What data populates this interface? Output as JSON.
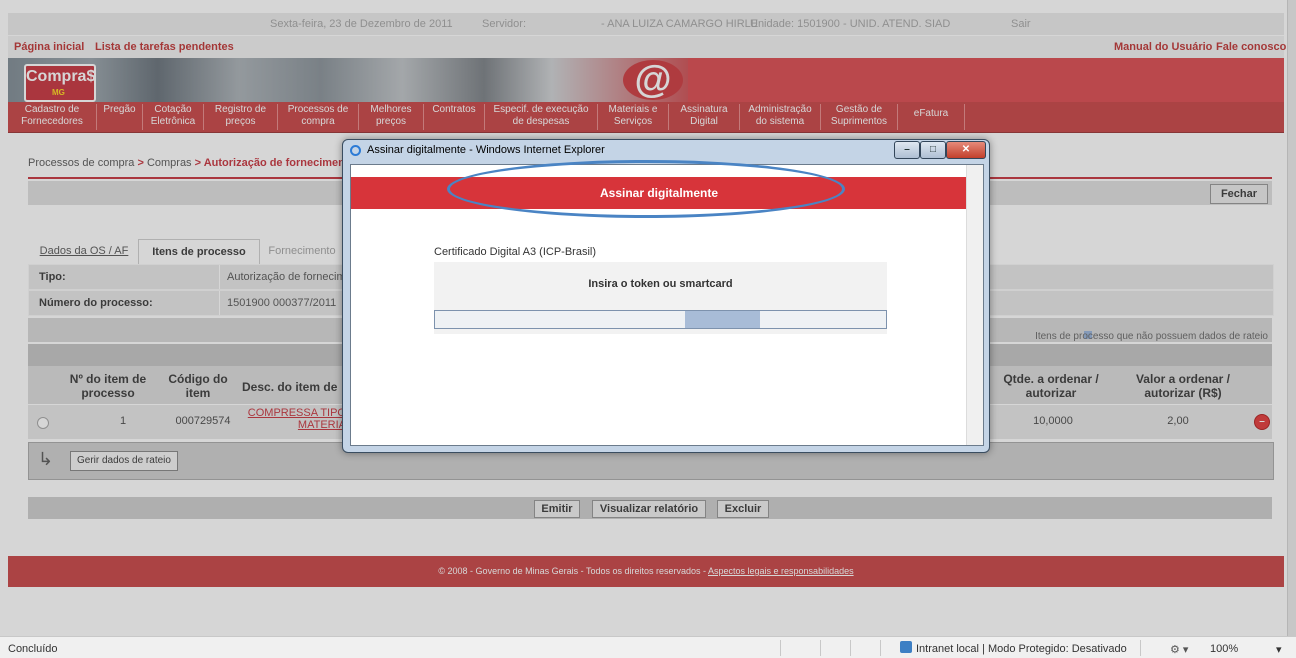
{
  "topbar": {
    "date": "Sexta-feira, 23 de Dezembro de 2011",
    "servidor_label": "Servidor:",
    "servidor_name": "- ANA LUIZA CAMARGO HIRLE",
    "unidade": "Unidade: 1501900 - UNID. ATEND. SIAD",
    "sair": "Sair"
  },
  "links": {
    "home": "Página inicial",
    "tasks": "Lista de tarefas pendentes",
    "manual": "Manual do Usuário",
    "contact": "Fale conosco"
  },
  "banner": {
    "logo": "Compra$",
    "logo_sub": "MG",
    "at": "@"
  },
  "nav": [
    {
      "line1": "Cadastro de",
      "line2": "Fornecedores"
    },
    {
      "line1": "Pregão",
      "line2": ""
    },
    {
      "line1": "Cotação",
      "line2": "Eletrônica"
    },
    {
      "line1": "Registro de",
      "line2": "preços"
    },
    {
      "line1": "Processos de",
      "line2": "compra"
    },
    {
      "line1": "Melhores",
      "line2": "preços"
    },
    {
      "line1": "Contratos",
      "line2": ""
    },
    {
      "line1": "Especif. de execução",
      "line2": "de despesas"
    },
    {
      "line1": "Materiais e",
      "line2": "Serviços"
    },
    {
      "line1": "Assinatura",
      "line2": "Digital"
    },
    {
      "line1": "Administração",
      "line2": "do sistema"
    },
    {
      "line1": "Gestão de",
      "line2": "Suprimentos"
    },
    {
      "line1": "eFatura",
      "line2": ""
    }
  ],
  "breadcrumb": {
    "part1": "Processos de compra",
    "sep": " > ",
    "part2": "Compras",
    "part3": "Autorização de fornecimen"
  },
  "buttons": {
    "fechar": "Fechar",
    "gerir_rateio": "Gerir dados de rateio",
    "emitir": "Emitir",
    "visualizar": "Visualizar relatório",
    "excluir": "Excluir"
  },
  "tabs": [
    "Dados da OS / AF",
    "Itens de processo",
    "Fornecimento"
  ],
  "info": {
    "tipo_label": "Tipo:",
    "tipo_value": "Autorização de fornecim",
    "numero_label": "Número do processo:",
    "numero_value": "1501900 000377/2011"
  },
  "legend": "Itens de processo que não possuem dados de rateio",
  "table": {
    "headers": {
      "item": "Nº do item de processo",
      "codigo": "Código do item",
      "desc": "Desc. do item de",
      "qtde": "Qtde. a ordenar / autorizar",
      "valor": "Valor a ordenar / autorizar (R$)"
    },
    "row": {
      "item": "1",
      "codigo": "000729574",
      "desc_line1": "COMPRESSA TIPO",
      "desc_line2": "MATERIA",
      "qtde": "10,0000",
      "valor": "2,00"
    }
  },
  "footer": {
    "text": "© 2008 - Governo de Minas Gerais - Todos os direitos reservados - ",
    "link": "Aspectos legais e responsabilidades"
  },
  "statusbar": {
    "left": "Concluído",
    "zone": "Intranet local | Modo Protegido: Desativado",
    "zoom": "100%"
  },
  "dialog": {
    "title": "Assinar digitalmente - Windows Internet Explorer",
    "header": "Assinar digitalmente",
    "cert_label": "Certificado Digital A3 (ICP-Brasil)",
    "message": "Insira o token ou smartcard",
    "progress": 0.55
  },
  "colors": {
    "brand_red": "#c22d2f",
    "highlight_ellipse": "#4a84c4"
  }
}
